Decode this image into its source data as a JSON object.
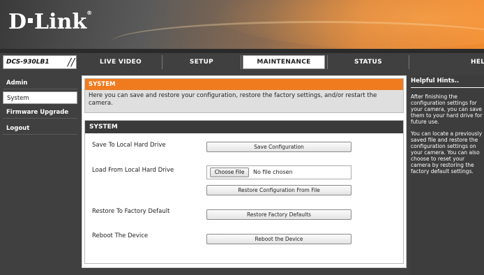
{
  "brand": {
    "logo_left": "D",
    "logo_right": "Link",
    "registered": "®"
  },
  "nav": {
    "model": "DCS-930LB1",
    "tabs": [
      {
        "label": "LIVE VIDEO",
        "active": false
      },
      {
        "label": "SETUP",
        "active": false
      },
      {
        "label": "MAINTENANCE",
        "active": true
      },
      {
        "label": "STATUS",
        "active": false
      },
      {
        "label": "HELP",
        "active": false
      }
    ]
  },
  "sidebar": {
    "items": [
      {
        "label": "Admin",
        "active": false
      },
      {
        "label": "System",
        "active": true
      },
      {
        "label": "Firmware Upgrade",
        "active": false
      },
      {
        "label": "Logout",
        "active": false
      }
    ]
  },
  "intro": {
    "title": "SYSTEM",
    "text": "Here you can save and restore your configuration, restore the factory settings, and/or restart the camera."
  },
  "system": {
    "title": "SYSTEM",
    "save_label": "Save To Local Hard Drive",
    "save_button": "Save Configuration",
    "load_label": "Load From Local Hard Drive",
    "choose_file_button": "Choose File",
    "file_status": "No file chosen",
    "restore_file_button": "Restore Configuration From File",
    "factory_label": "Restore To Factory Default",
    "factory_button": "Restore Factory Defaults",
    "reboot_label": "Reboot The Device",
    "reboot_button": "Reboot the Device"
  },
  "hints": {
    "title": "Helpful Hints..",
    "paragraph1": [
      "After finishing the",
      "configuration settings for",
      "your camera, you can save",
      "them to your hard drive for",
      "future use."
    ],
    "paragraph2": [
      "You can locate a previously",
      "saved file and restore the",
      "configuration settings on",
      "your camera. You can also",
      "choose to reset your",
      "camera by restoring the",
      "factory default settings."
    ]
  },
  "colors": {
    "accent": "#f07b1f",
    "dark": "#404040",
    "panel_title": "#3a3a3a"
  }
}
